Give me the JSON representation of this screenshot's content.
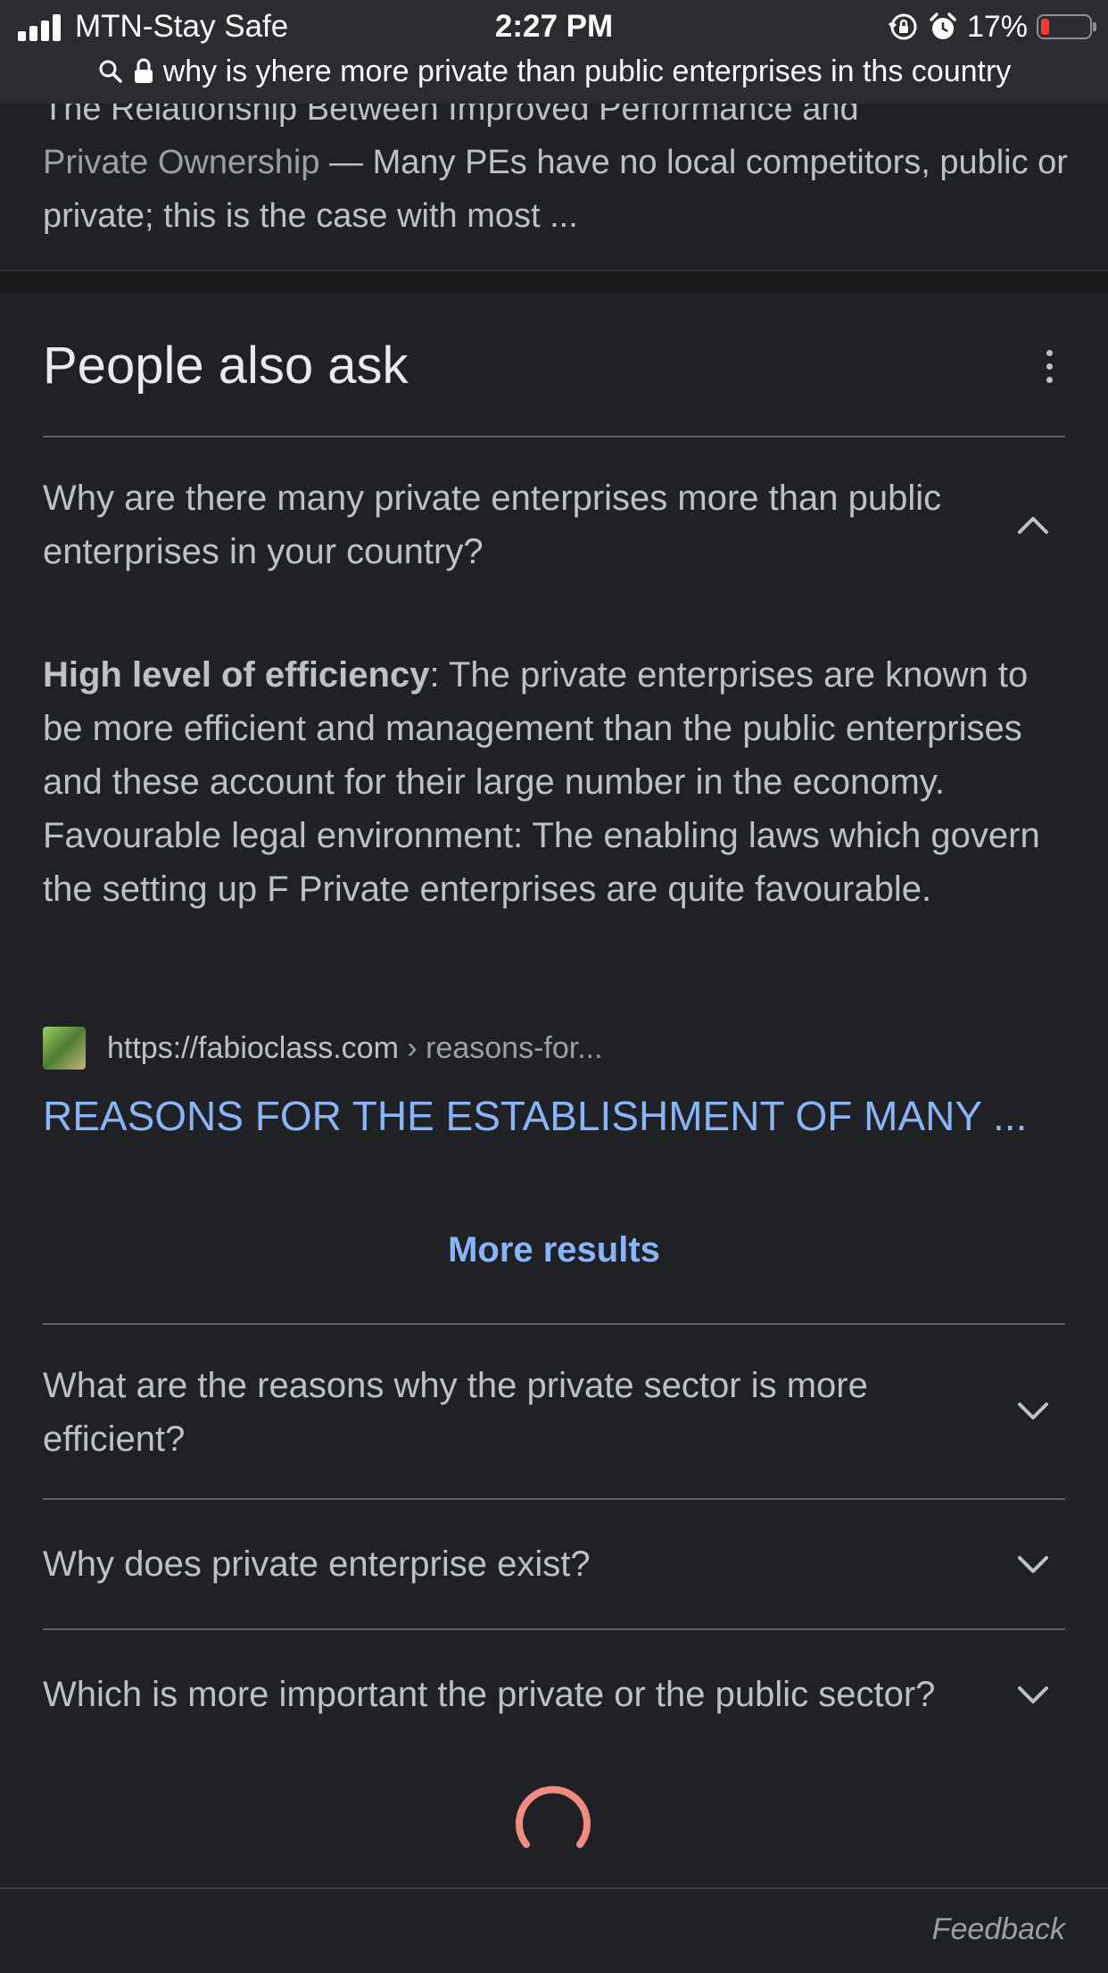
{
  "status_bar": {
    "carrier": "MTN-Stay Safe",
    "time": "2:27 PM",
    "battery_percent": "17%",
    "battery_level": 0.17,
    "icons": [
      "signal-icon",
      "orientation-lock-icon",
      "alarm-icon",
      "battery-icon"
    ]
  },
  "url_bar": {
    "query": "why is yhere more private than public enterprises in ths country",
    "icons": [
      "search-icon",
      "lock-icon"
    ]
  },
  "previous_result": {
    "title_fragment": "The Relationship Between Improved Performance and",
    "date_fragment": "Private Ownership",
    "separator": " — ",
    "snippet": "Many PEs have no local competitors, public or private; this is the case with most ..."
  },
  "people_also_ask": {
    "title": "People also ask",
    "menu_icon": "more-vert-icon",
    "expanded": {
      "question": "Why are there many private enterprises more than public enterprises in your country?",
      "answer_bold": "High level of efficiency",
      "answer_rest": ": The private enterprises are known to be more efficient and management than the public enterprises and these account for their large number in the economy. Favourable legal environment: The enabling laws which govern the setting up F Private enterprises are quite favourable.",
      "source_domain": "https://fabioclass.com",
      "source_path": " › reasons-for...",
      "link_title": "REASONS FOR THE ESTABLISHMENT OF MANY ...",
      "more_results": "More results"
    },
    "questions": [
      "What are the reasons why the private sector is more efficient?",
      "Why does private enterprise exist?",
      "Which is more important the private or the public sector?"
    ]
  },
  "footer": {
    "feedback": "Feedback"
  },
  "colors": {
    "background": "#202124",
    "text": "#bdc1c6",
    "link": "#8ab4f8",
    "spinner": "#f28b82"
  }
}
